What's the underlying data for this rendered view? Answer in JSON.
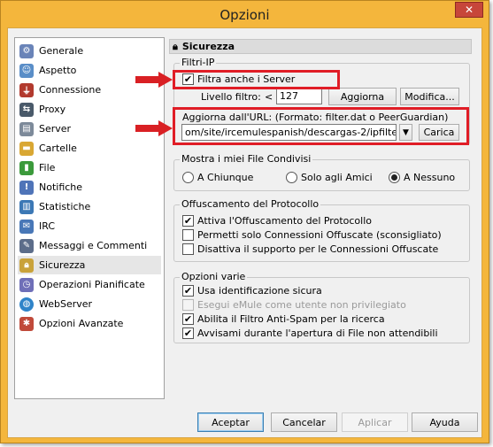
{
  "window": {
    "title": "Opzioni",
    "close_symbol": "✕"
  },
  "sidebar": {
    "items": [
      {
        "label": "Generale",
        "icon": "gears-icon",
        "color": "#6a84b8"
      },
      {
        "label": "Aspetto",
        "icon": "person-icon",
        "color": "#5a8ec8"
      },
      {
        "label": "Connessione",
        "icon": "plug-icon",
        "color": "#b23a2e"
      },
      {
        "label": "Proxy",
        "icon": "proxy-icon",
        "color": "#4a5a6a"
      },
      {
        "label": "Server",
        "icon": "server-icon",
        "color": "#7d8a9a"
      },
      {
        "label": "Cartelle",
        "icon": "folder-icon",
        "color": "#d9a733"
      },
      {
        "label": "File",
        "icon": "file-icon",
        "color": "#3b9a3b"
      },
      {
        "label": "Notifiche",
        "icon": "notification-icon",
        "color": "#4f74b8"
      },
      {
        "label": "Statistiche",
        "icon": "statistics-icon",
        "color": "#3c78b5"
      },
      {
        "label": "IRC",
        "icon": "irc-icon",
        "color": "#4877b7"
      },
      {
        "label": "Messaggi e Commenti",
        "icon": "messages-icon",
        "color": "#5c6d8a"
      },
      {
        "label": "Sicurezza",
        "icon": "lock-icon",
        "color": "#c9a23a",
        "selected": true
      },
      {
        "label": "Operazioni Pianificate",
        "icon": "scheduler-icon",
        "color": "#6f6fb8"
      },
      {
        "label": "WebServer",
        "icon": "globe-icon",
        "color": "#2f84c9"
      },
      {
        "label": "Opzioni Avanzate",
        "icon": "advanced-icon",
        "color": "#c04a3a"
      }
    ]
  },
  "panel": {
    "title": "Sicurezza",
    "ipfilter": {
      "legend": "Filtri-IP",
      "filter_servers_label": "Filtra anche i Server",
      "filter_servers_checked": true,
      "level_label": "Livello filtro:",
      "level_operator": "<",
      "level_value": "127",
      "reload_button": "Aggiorna",
      "edit_button": "Modifica...",
      "update_url_label": "Aggiorna dall'URL: (Formato: filter.dat o PeerGuardian)",
      "update_url_value": "om/site/ircemulespanish/descargas-2/ipfilter.zip",
      "load_button": "Carica"
    },
    "shared_files": {
      "legend": "Mostra i miei File Condivisi",
      "options": [
        "A Chiunque",
        "Solo agli Amici",
        "A Nessuno"
      ],
      "selected": "A Nessuno"
    },
    "obfuscation": {
      "legend": "Offuscamento del Protocollo",
      "items": [
        {
          "label": "Attiva l'Offuscamento del Protocollo",
          "checked": true
        },
        {
          "label": "Permetti solo Connessioni Offuscate (sconsigliato)",
          "checked": false
        },
        {
          "label": "Disattiva il supporto per le Connessioni Offuscate",
          "checked": false
        }
      ]
    },
    "misc": {
      "legend": "Opzioni varie",
      "items": [
        {
          "label": "Usa identificazione sicura",
          "checked": true,
          "disabled": false
        },
        {
          "label": "Esegui eMule come utente non privilegiato",
          "checked": false,
          "disabled": true
        },
        {
          "label": "Abilita il Filtro Anti-Spam per la ricerca",
          "checked": true,
          "disabled": false
        },
        {
          "label": "Avvisami durante l'apertura di File non attendibili",
          "checked": true,
          "disabled": false
        }
      ]
    }
  },
  "footer": {
    "accept": "Aceptar",
    "cancel": "Cancelar",
    "apply": "Aplicar",
    "help": "Ayuda"
  },
  "annotation_color": "#e01d26"
}
